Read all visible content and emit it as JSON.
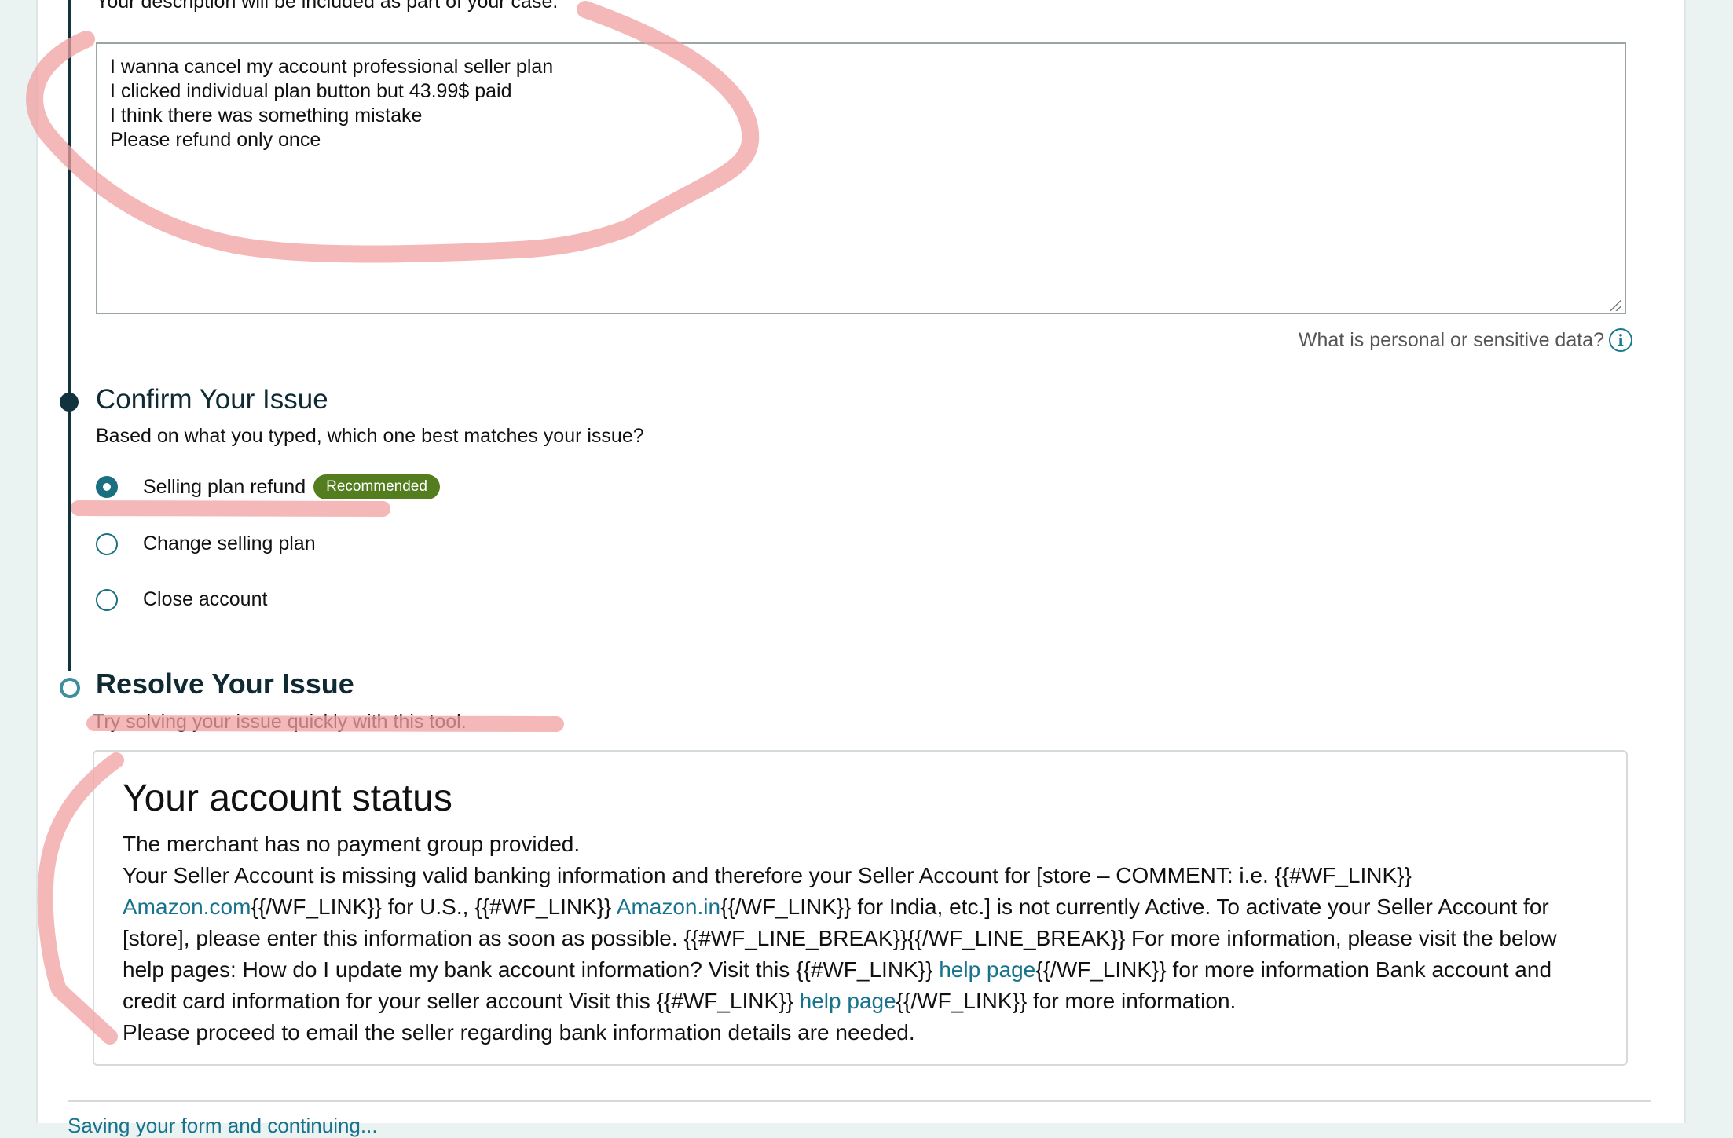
{
  "description_note": "Your description will be included as part of your case.",
  "description_text": "I wanna cancel my account professional seller plan\nI clicked individual plan button but 43.99$ paid\nI think there was something mistake\nPlease refund only once",
  "sensitive_link": "What is personal or sensitive data?",
  "confirm": {
    "title": "Confirm Your Issue",
    "subtitle": "Based on what you typed, which one best matches your issue?",
    "options": [
      {
        "label": "Selling plan refund",
        "selected": true,
        "badge": "Recommended"
      },
      {
        "label": "Change selling plan",
        "selected": false
      },
      {
        "label": "Close account",
        "selected": false
      }
    ]
  },
  "resolve": {
    "title": "Resolve Your Issue",
    "subtitle": "Try solving your issue quickly with this tool."
  },
  "status": {
    "title": "Your account status",
    "line1": "The merchant has no payment group provided.",
    "p_a": "Your Seller Account is missing valid banking information and therefore your Seller Account for [store – COMMENT: i.e. {{#WF_LINK}} ",
    "link_amazon_com": "Amazon.com",
    "p_b": "{{/WF_LINK}} for U.S., {{#WF_LINK}} ",
    "link_amazon_in": "Amazon.in",
    "p_c": "{{/WF_LINK}} for India, etc.] is not currently Active. To activate your Seller Account for [store], please enter this information as soon as possible. {{#WF_LINE_BREAK}}{{/WF_LINE_BREAK}} For more information, please visit the below help pages: How do I update my bank account information? Visit this {{#WF_LINK}} ",
    "link_help_1": "help page",
    "p_d": "{{/WF_LINK}} for more information Bank account and credit card information for your seller account Visit this {{#WF_LINK}} ",
    "link_help_2": "help page",
    "p_e": "{{/WF_LINK}} for more information.",
    "line_last": "Please proceed to email the seller regarding bank information details are needed."
  },
  "bottom_link": "Saving your form and continuing...",
  "colors": {
    "accent": "#17728c",
    "timeline": "#11333d",
    "badge": "#537d1f",
    "annotation": "#f0a0a0"
  }
}
